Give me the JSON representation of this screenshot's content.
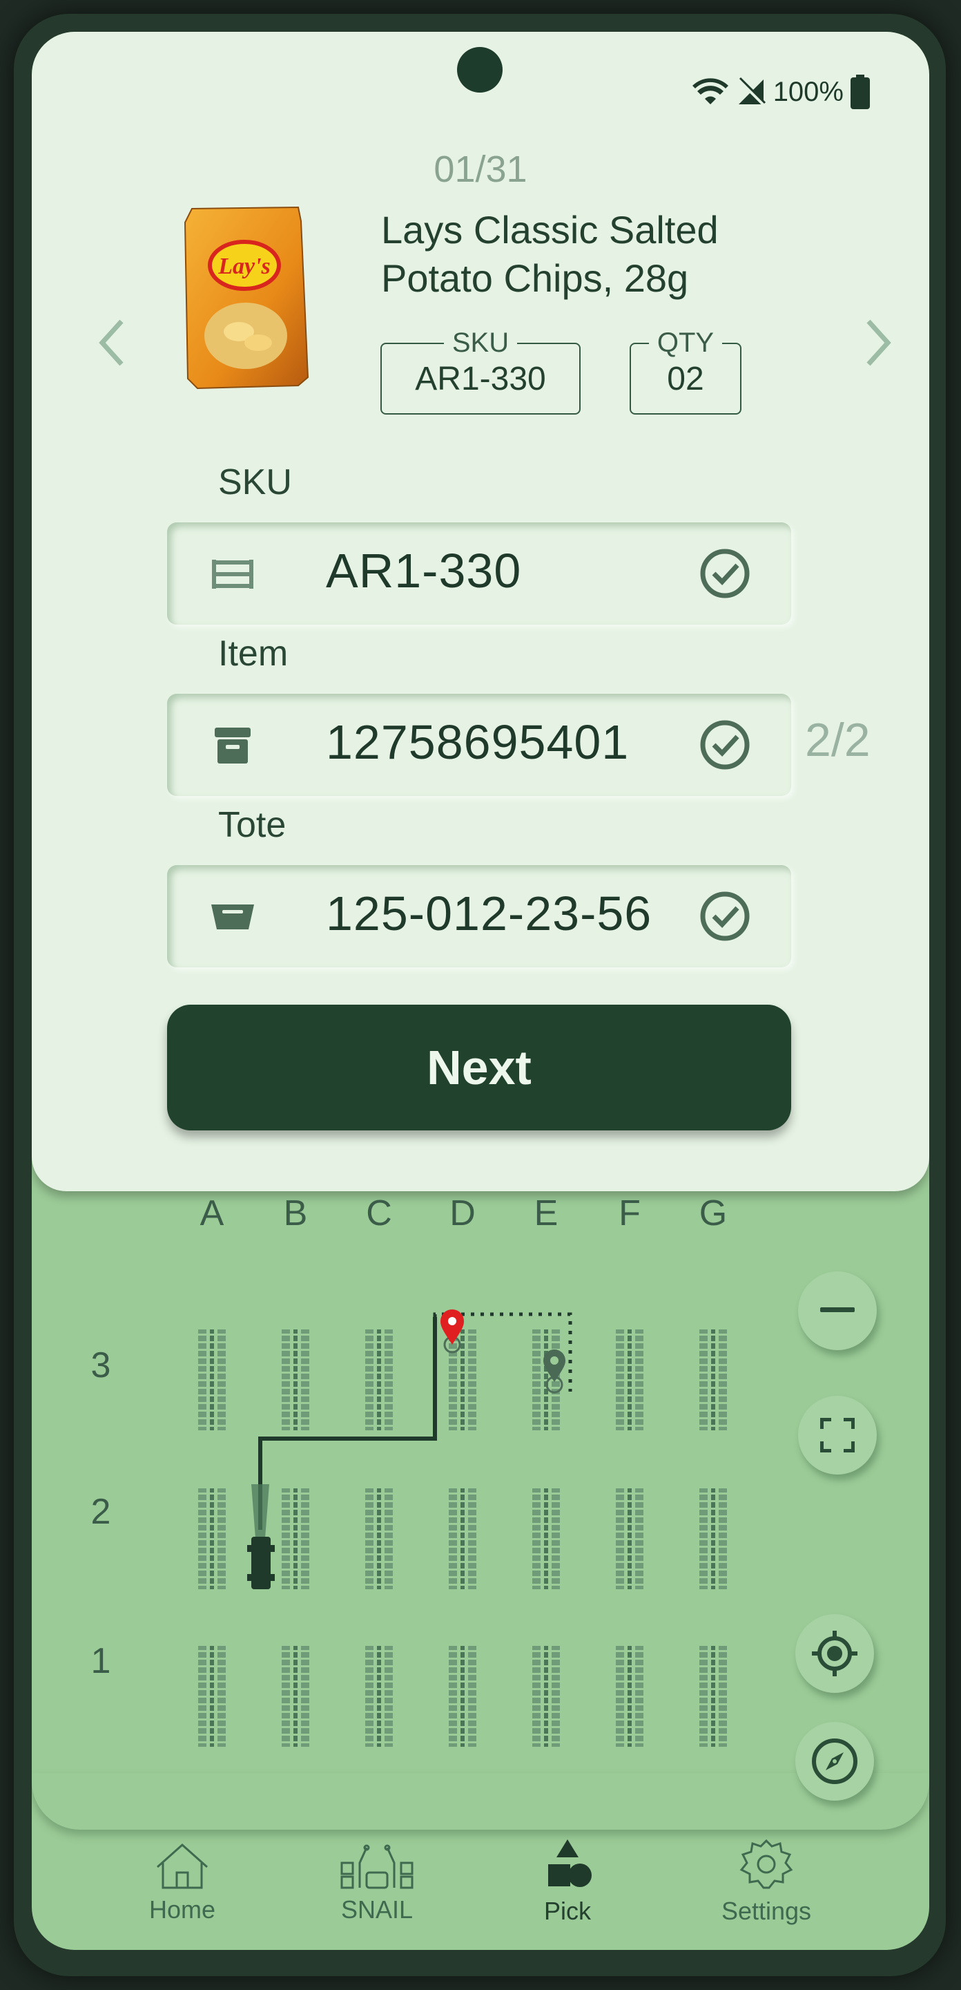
{
  "status_bar": {
    "battery": "100%"
  },
  "pick": {
    "counter": "01/31",
    "product_title_line1": "Lays Classic Salted",
    "product_title_line2": "Potato Chips, 28g",
    "sku_label": "SKU",
    "sku_value": "AR1-330",
    "qty_label": "QTY",
    "qty_value": "02",
    "product_image_text": "Lay's"
  },
  "fields": [
    {
      "label": "SKU",
      "value": "AR1-330",
      "icon": "shelf-icon"
    },
    {
      "label": "Item",
      "value": "12758695401",
      "icon": "archive-box-icon"
    },
    {
      "label": "Tote",
      "value": "125-012-23-56",
      "icon": "tote-bin-icon"
    }
  ],
  "item_progress": "2/2",
  "next_button": "Next",
  "map": {
    "columns": [
      "A",
      "B",
      "C",
      "D",
      "E",
      "F",
      "G"
    ],
    "rows": [
      "3",
      "2",
      "1"
    ]
  },
  "nav": {
    "items": [
      {
        "label": "Home",
        "icon": "home-icon"
      },
      {
        "label": "SNAIL",
        "icon": "snail-robot-icon"
      },
      {
        "label": "Pick",
        "icon": "shapes-icon",
        "active": true
      },
      {
        "label": "Settings",
        "icon": "gear-icon"
      }
    ]
  },
  "colors": {
    "accent": "#21432e",
    "card": "#e6f3e4",
    "map": "#9bcb97",
    "pin": "#e02020"
  }
}
